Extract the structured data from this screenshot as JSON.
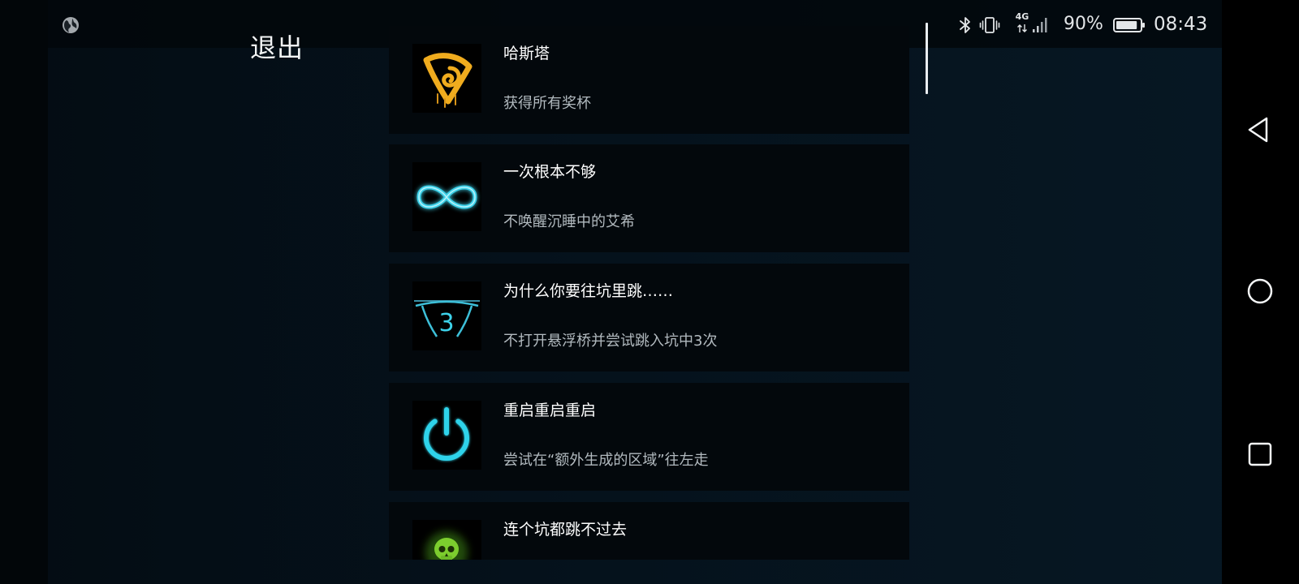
{
  "status_bar": {
    "network_type": "4G",
    "battery_percent": "90%",
    "battery_level": 0.9,
    "time": "08:43",
    "icons": [
      "globe-icon",
      "bluetooth-icon",
      "vibrate-icon",
      "signal-icon",
      "battery-icon"
    ]
  },
  "header": {
    "exit_label": "退出"
  },
  "list": {
    "scroll_fraction": 0
  },
  "achievements": [
    {
      "icon": "hastur-sigil-icon",
      "title": "哈斯塔",
      "description": "获得所有奖杯"
    },
    {
      "icon": "infinity-icon",
      "title": "一次根本不够",
      "description": "不唤醒沉睡中的艾希"
    },
    {
      "icon": "bridge-icon",
      "icon_text": "3",
      "title": "为什么你要往坑里跳……",
      "description": "不打开悬浮桥并尝试跳入坑中3次"
    },
    {
      "icon": "power-icon",
      "title": "重启重启重启",
      "description": "尝试在“额外生成的区域”往左走"
    },
    {
      "icon": "skull-icon",
      "title": "连个坑都跳不过去"
    }
  ],
  "nav_bar": {
    "icons": [
      "back-icon",
      "home-icon",
      "recents-icon"
    ]
  },
  "colors": {
    "accent_cyan": "#3dd2ea",
    "sigil_yellow": "#f0ac1e",
    "skull_green": "#7ccd2e",
    "background": "#05111b",
    "card": "#03080c"
  }
}
